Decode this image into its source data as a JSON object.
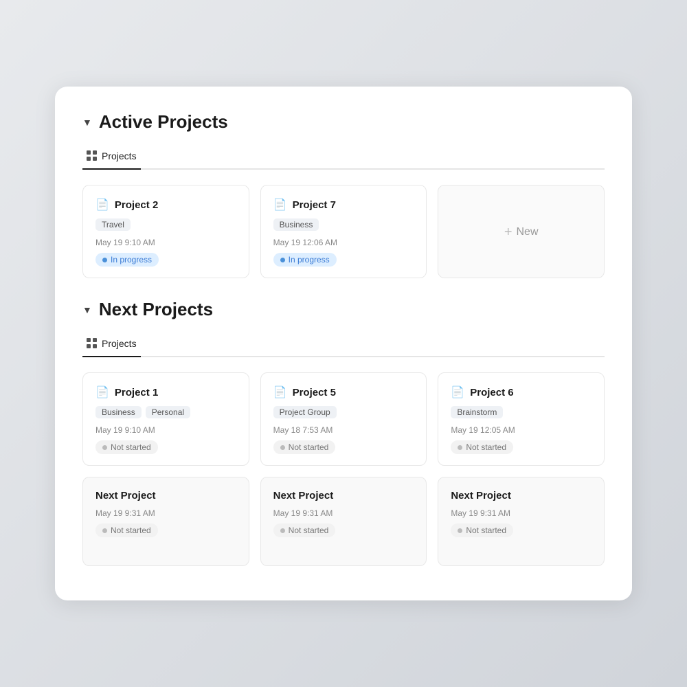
{
  "active": {
    "section_title": "Active Projects",
    "tab_label": "Projects",
    "cards": [
      {
        "title": "Project 2",
        "tags": [
          "Travel"
        ],
        "date": "May 19 9:10 AM",
        "status": "In progress",
        "status_type": "in-progress"
      },
      {
        "title": "Project 7",
        "tags": [
          "Business"
        ],
        "date": "May 19 12:06 AM",
        "status": "In progress",
        "status_type": "in-progress"
      }
    ],
    "new_label": "New"
  },
  "next": {
    "section_title": "Next Projects",
    "tab_label": "Projects",
    "cards": [
      {
        "title": "Project 1",
        "tags": [
          "Business",
          "Personal"
        ],
        "date": "May 19 9:10 AM",
        "status": "Not started",
        "status_type": "not-started"
      },
      {
        "title": "Project 5",
        "tags": [
          "Project Group"
        ],
        "date": "May 18 7:53 AM",
        "status": "Not started",
        "status_type": "not-started"
      },
      {
        "title": "Project 6",
        "tags": [
          "Brainstorm"
        ],
        "date": "May 19 12:05 AM",
        "status": "Not started",
        "status_type": "not-started"
      },
      {
        "title": "Next Project",
        "tags": [],
        "date": "May 19 9:31 AM",
        "status": "Not started",
        "status_type": "not-started"
      },
      {
        "title": "Next Project",
        "tags": [],
        "date": "May 19 9:31 AM",
        "status": "Not started",
        "status_type": "not-started"
      },
      {
        "title": "Next Project",
        "tags": [],
        "date": "May 19 9:31 AM",
        "status": "Not started",
        "status_type": "not-started"
      }
    ]
  }
}
